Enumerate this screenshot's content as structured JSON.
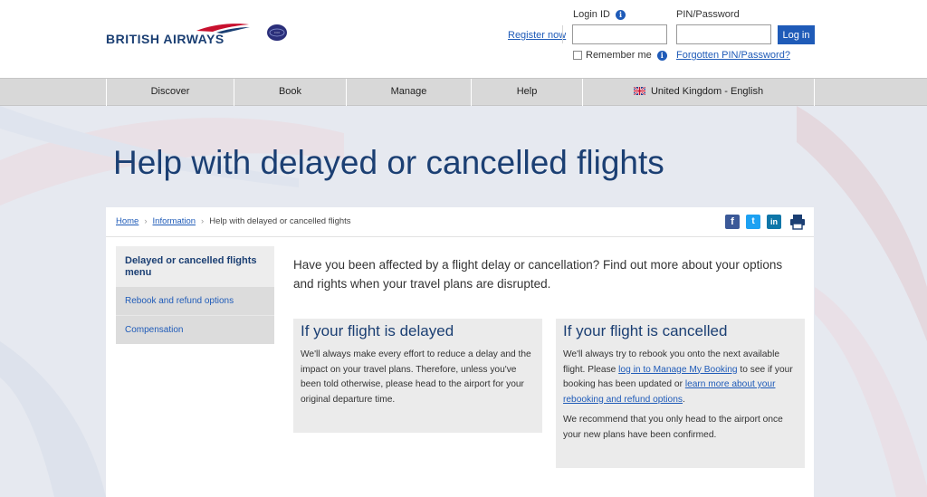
{
  "brand": {
    "name": "BRITISH AIRWAYS"
  },
  "header": {
    "register_label": "Register now",
    "login_id_label": "Login ID",
    "pin_label": "PIN/Password",
    "login_id_value": "",
    "pin_value": "",
    "login_button": "Log in",
    "remember_label": "Remember me",
    "forgot_label": "Forgotten PIN/Password?",
    "info_glyph": "i"
  },
  "nav": {
    "items": [
      "Discover",
      "Book",
      "Manage",
      "Help",
      "United Kingdom - English"
    ]
  },
  "page": {
    "title": "Help with delayed or cancelled flights"
  },
  "breadcrumb": {
    "items": [
      "Home",
      "Information",
      "Help with delayed or cancelled flights"
    ],
    "separator": "›"
  },
  "share": {
    "facebook": "f",
    "twitter": "t",
    "linkedin": "in"
  },
  "sidebar": {
    "heading": "Delayed or cancelled flights menu",
    "items": [
      "Rebook and refund options",
      "Compensation"
    ]
  },
  "main": {
    "intro": "Have you been affected by a flight delay or cancellation? Find out more about your options and rights when your travel plans are disrupted.",
    "delayed": {
      "title": "If your flight is delayed",
      "body": "We'll always make every effort to reduce a delay and the impact on your travel plans. Therefore, unless you've been told otherwise, please head to the airport for your original departure time."
    },
    "cancelled": {
      "title": "If your flight is cancelled",
      "p1_a": "We'll always try to rebook you onto the next available flight. Please ",
      "p1_link1": "log in to Manage My Booking",
      "p1_b": " to see if your booking has been updated or ",
      "p1_link2": "learn more about your rebooking and refund options",
      "p1_c": ".",
      "p2": "We recommend that you only head to the airport once your new plans have been confirmed."
    }
  },
  "colors": {
    "brand_navy": "#1b3f73",
    "link_blue": "#1f5bb8",
    "nav_grey": "#d8d8d8"
  },
  "icons": [
    "british-airways-logo",
    "oneworld-logo",
    "info-icon",
    "uk-flag-icon",
    "facebook-icon",
    "twitter-icon",
    "linkedin-icon",
    "print-icon"
  ]
}
